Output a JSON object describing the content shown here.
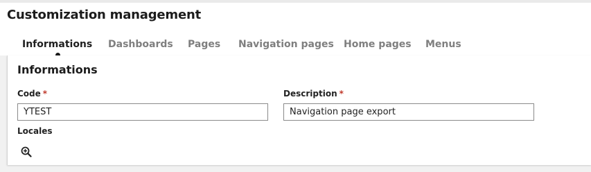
{
  "page": {
    "title": "Customization management"
  },
  "tabs": [
    {
      "label": "Informations",
      "active": true
    },
    {
      "label": "Dashboards",
      "active": false
    },
    {
      "label": "Pages",
      "active": false
    },
    {
      "label": "Navigation pages",
      "active": false
    },
    {
      "label": "Home pages",
      "active": false
    },
    {
      "label": "Menus",
      "active": false
    }
  ],
  "section": {
    "title": "Informations",
    "code": {
      "label": "Code",
      "required_mark": "*",
      "value": "YTEST"
    },
    "description": {
      "label": "Description",
      "required_mark": "*",
      "value": "Navigation page export"
    },
    "locales": {
      "label": "Locales",
      "icon": "zoom-in-icon"
    }
  },
  "colors": {
    "background": "#f1f1f1",
    "active_tab": "#1f1f1f",
    "inactive_tab": "#7f7f7f",
    "required": "#c0392b"
  }
}
